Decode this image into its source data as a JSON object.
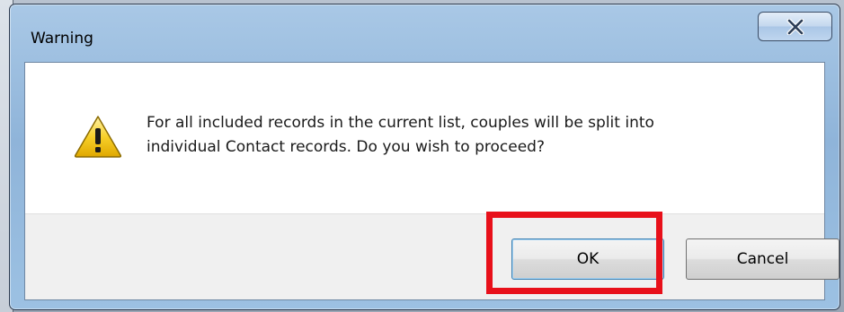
{
  "window": {
    "title": "Warning",
    "close_icon": "close-icon"
  },
  "dialog": {
    "icon": "warning-icon",
    "message": "For all included records in the current list, couples will be split into\nindividual Contact records.  Do you wish to proceed?"
  },
  "buttons": {
    "ok_label": "OK",
    "cancel_label": "Cancel"
  },
  "annotation": {
    "highlight_color": "#e8101a",
    "highlight_target": "ok-button"
  },
  "colors": {
    "titlebar": "#9cc1e3",
    "warning_yellow": "#f5c400",
    "button_area": "#f0f0f0"
  }
}
